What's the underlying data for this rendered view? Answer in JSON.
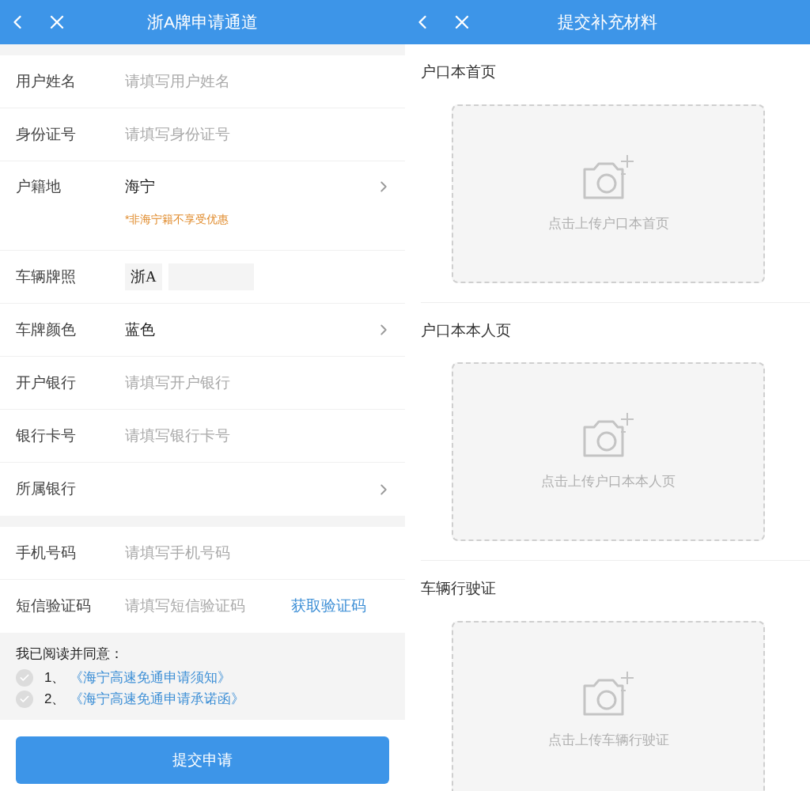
{
  "screens": [
    {
      "kind": "form",
      "title": "浙A牌申请通道",
      "sections": [
        {
          "fields": [
            {
              "kind": "input",
              "label": "用户姓名",
              "placeholder": "请填写用户姓名"
            },
            {
              "kind": "input",
              "label": "身份证号",
              "placeholder": "请填写身份证号"
            },
            {
              "kind": "select",
              "label": "户籍地",
              "value": "海宁",
              "note": "*非海宁籍不享受优惠"
            },
            {
              "kind": "plate",
              "label": "车辆牌照",
              "prefix": "浙A"
            },
            {
              "kind": "select",
              "label": "车牌颜色",
              "value": "蓝色"
            },
            {
              "kind": "input",
              "label": "开户银行",
              "placeholder": "请填写开户银行"
            },
            {
              "kind": "input",
              "label": "银行卡号",
              "placeholder": "请填写银行卡号"
            },
            {
              "kind": "select",
              "label": "所属银行"
            }
          ]
        },
        {
          "fields": [
            {
              "kind": "input",
              "label": "手机号码",
              "placeholder": "请填写手机号码"
            },
            {
              "kind": "input",
              "label": "短信验证码",
              "placeholder": "请填写短信验证码",
              "action": "获取验证码"
            }
          ]
        }
      ],
      "agreement": {
        "heading": "我已阅读并同意：",
        "items": [
          {
            "number": "1、",
            "link": "《海宁高速免通申请须知》",
            "checked": false
          },
          {
            "number": "2、",
            "link": "《海宁高速免通申请承诺函》",
            "checked": false
          }
        ]
      },
      "submit": "提交申请"
    },
    {
      "kind": "uploads",
      "title": "提交补充材料",
      "uploads": [
        {
          "title": "户口本首页",
          "hint": "点击上传户口本首页"
        },
        {
          "title": "户口本本人页",
          "hint": "点击上传户口本本人页"
        },
        {
          "title": "车辆行驶证",
          "hint": "点击上传车辆行驶证"
        }
      ]
    }
  ]
}
